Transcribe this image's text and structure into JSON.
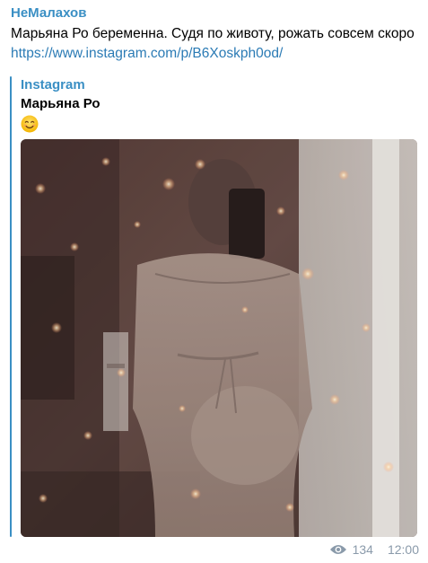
{
  "message": {
    "sender": "НеМалахов",
    "text": "Марьяна Ро беременна. Судя по животу, рожать совсем скоро",
    "link": "https://www.instagram.com/p/B6Xoskph0od/",
    "views": "134",
    "time": "12:00"
  },
  "link_preview": {
    "site_name": "Instagram",
    "title": "Марьяна Ро",
    "emoji": "smiling-face-emoji"
  },
  "icons": {
    "views": "eye-icon"
  },
  "colors": {
    "accent": "#3a8fc4",
    "link": "#2b7bb5",
    "meta": "#8a9aaa"
  }
}
